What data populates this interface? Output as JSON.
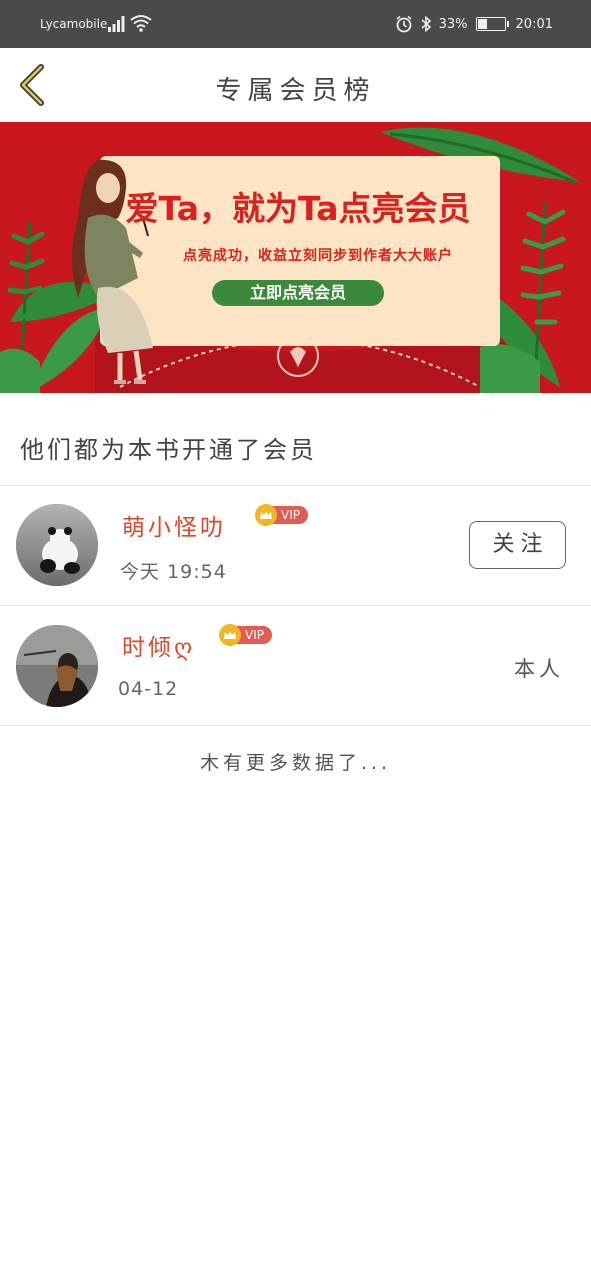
{
  "status_bar": {
    "carrier": "Lycamobile",
    "battery": "33%",
    "time": "20:01",
    "icons": [
      "signal-icon",
      "wifi-icon",
      "alarm-icon",
      "bluetooth-icon",
      "battery-icon"
    ]
  },
  "header": {
    "title": "专属会员榜",
    "back_icon": "chevron-left-icon"
  },
  "banner": {
    "headline": "爱Ta，就为Ta点亮会员",
    "subline": "点亮成功，收益立刻同步到作者大大账户",
    "cta": "立即点亮会员",
    "colors": {
      "background": "#c8161d",
      "card": "#fce4c4",
      "cta": "#3b8a3b",
      "text": "#d9211d"
    }
  },
  "section": {
    "title": "他们都为本书开通了会员"
  },
  "members": [
    {
      "name": "萌小怪叻",
      "badge": "VIP",
      "time": "今天 19:54",
      "action": "关注"
    },
    {
      "name": "时倾ღ",
      "badge": "VIP",
      "time": "04-12",
      "action": "本人"
    }
  ],
  "footer": {
    "no_more": "木有更多数据了..."
  },
  "colors": {
    "accent": "#d94a2c",
    "vip": "#e45a55",
    "crown": "#f2b622"
  }
}
